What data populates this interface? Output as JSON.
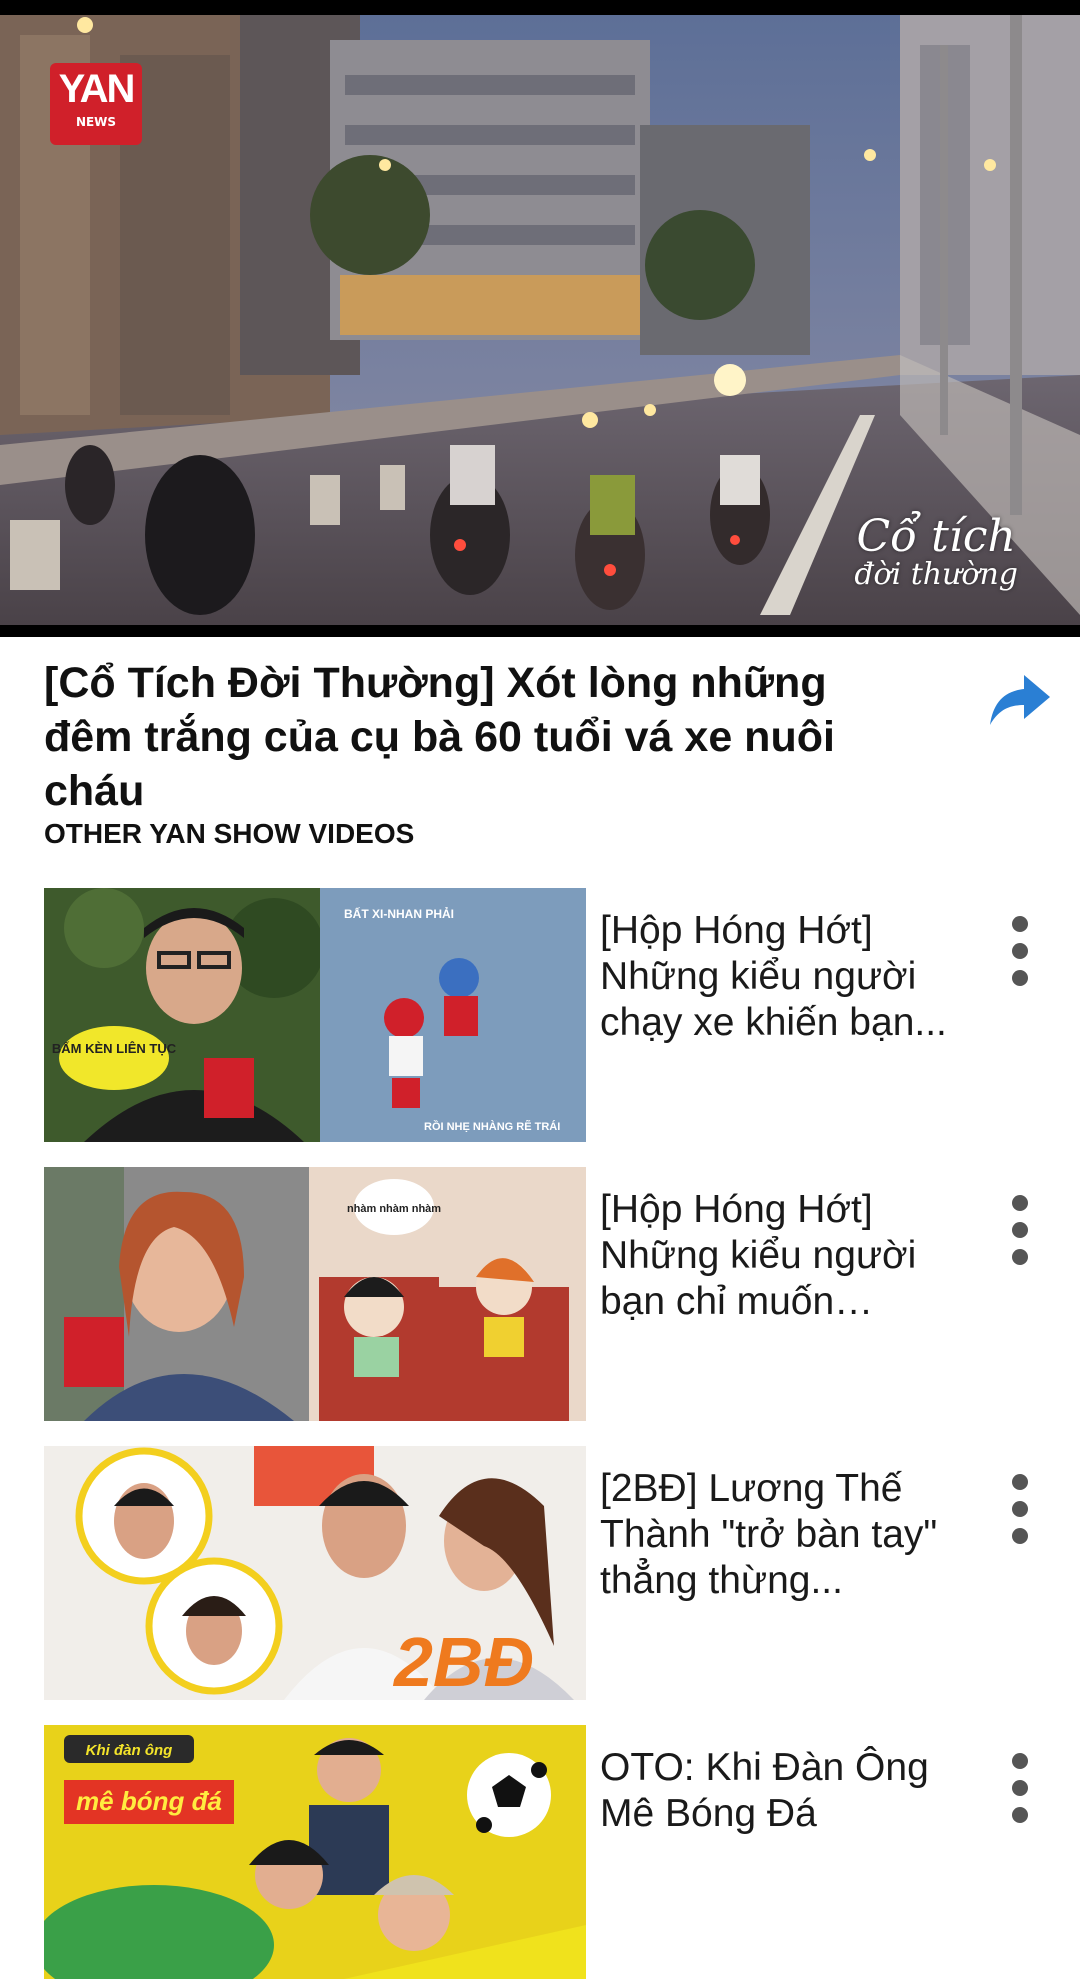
{
  "player": {
    "logo_text": "YAN",
    "logo_sub": "NEWS",
    "watermark_line1": "Cổ tích",
    "watermark_line2": "đời thường"
  },
  "video": {
    "title": "[Cổ Tích Đời Thường] Xót lòng những đêm trắng của cụ bà 60 tuổi vá xe nuôi cháu"
  },
  "section": {
    "heading": "OTHER YAN SHOW VIDEOS"
  },
  "videos": [
    {
      "title": "[Hộp Hóng Hớt] Những kiểu người chạy xe khiến bạn...",
      "thumb_texts": [
        "BẤT XI-NHAN PHẢI",
        "BẤM KÈN LIÊN TỤC",
        "RỒI NHẸ NHÀNG RẼ TRÁI"
      ]
    },
    {
      "title": "[Hộp Hóng Hớt] Những kiểu người bạn chỉ muốn \"tiễn...",
      "thumb_texts": [
        "nhàm nhàm nhàm"
      ]
    },
    {
      "title": "[2BĐ] Lương Thế Thành \"trở bàn tay\" thẳng thừng...",
      "thumb_texts": [
        "2BĐ"
      ]
    },
    {
      "title": "OTO: Khi Đàn Ông Mê Bóng Đá",
      "thumb_texts": [
        "Khi đàn ông",
        "mê bóng đá"
      ]
    }
  ],
  "colors": {
    "accent": "#2a7fd4",
    "brand": "#d0202a"
  },
  "icons": {
    "share": "share-icon",
    "more": "more-vertical-icon"
  }
}
